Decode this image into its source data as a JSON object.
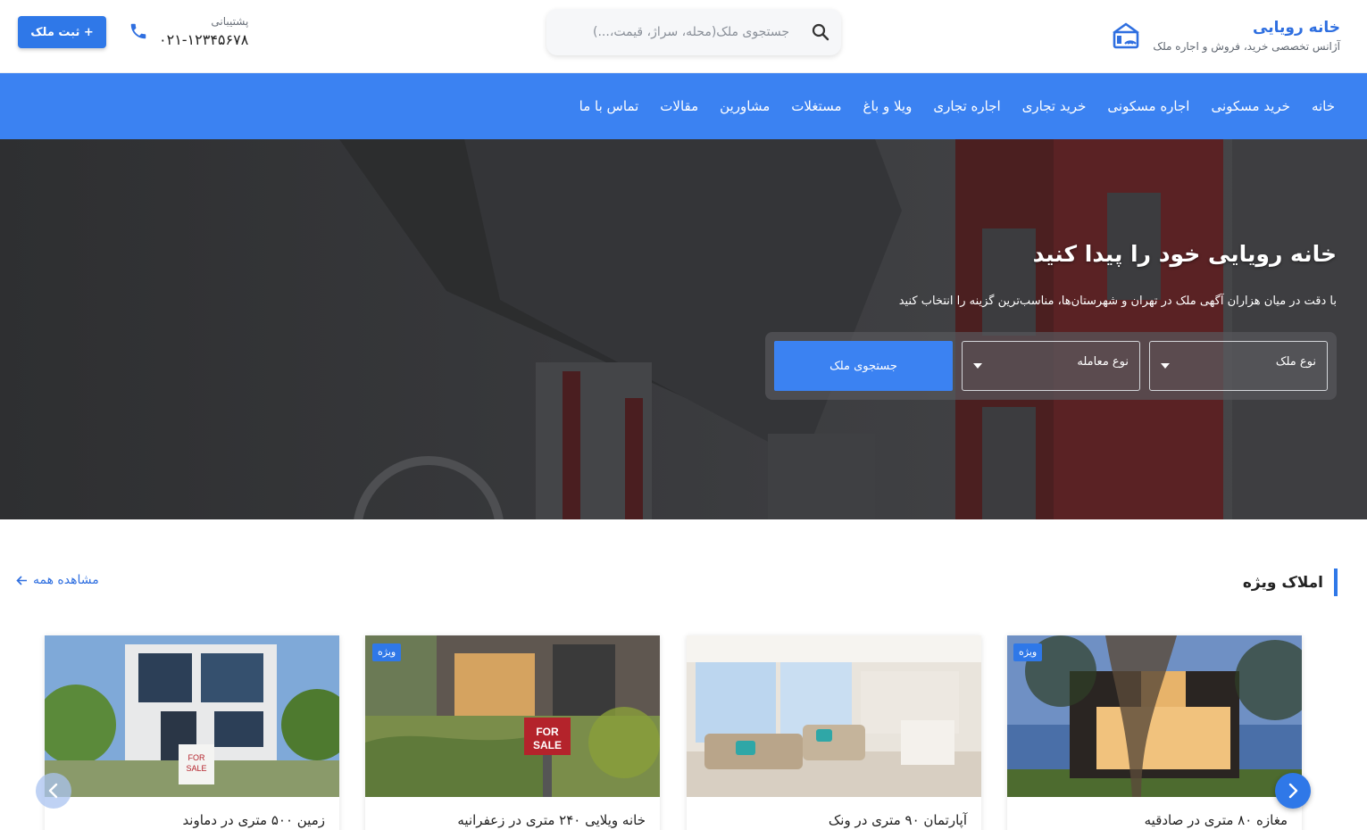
{
  "header": {
    "brand_name": "خانه رویایی",
    "brand_tagline": "آژانس تخصصی خرید، فروش و اجاره ملک",
    "search_placeholder": "جستجوی ملک(محله، سراژ، قیمت،...)",
    "support_label": "پشتیبانی",
    "support_phone": "۰۲۱-۱۲۳۴۵۶۷۸",
    "register_label": "+ ثبت ملک"
  },
  "nav": {
    "items": [
      "خانه",
      "خرید مسکونی",
      "اجاره مسکونی",
      "خرید تجاری",
      "اجاره تجاری",
      "ویلا و باغ",
      "مستغلات",
      "مشاورین",
      "مقالات",
      "تماس با ما"
    ]
  },
  "hero": {
    "title": "خانه رویایی خود را پیدا کنید",
    "subtitle": "با دقت در میان هزاران آگهی ملک در تهران و شهرستان‌ها، مناسب‌ترین گزینه را انتخاب کنید",
    "property_type_label": "نوع ملک",
    "deal_type_label": "نوع معامله",
    "search_button": "جستجوی ملک"
  },
  "featured": {
    "title": "املاک ویژه",
    "view_all": "مشاهده همه",
    "cards": [
      {
        "title": "مغازه ۸۰ متری در صادقیه",
        "badge": "ویژه"
      },
      {
        "title": "آپارتمان ۹۰ متری در ونک"
      },
      {
        "title": "خانه ویلایی ۲۴۰ متری در زعفرانیه",
        "badge": "ویژه"
      },
      {
        "title": "زمین ۵۰۰ متری در دماوند"
      }
    ]
  },
  "colors": {
    "accent": "#2f78e8",
    "nav_bg": "#3b82f2"
  },
  "icons": {
    "logo": "house-wifi-icon",
    "search": "search-icon",
    "phone": "phone-icon",
    "dropdown": "caret-down-icon",
    "view_all_arrow": "arrow-left-icon",
    "carousel_next": "chevron-right-icon",
    "carousel_prev": "chevron-left-icon"
  }
}
